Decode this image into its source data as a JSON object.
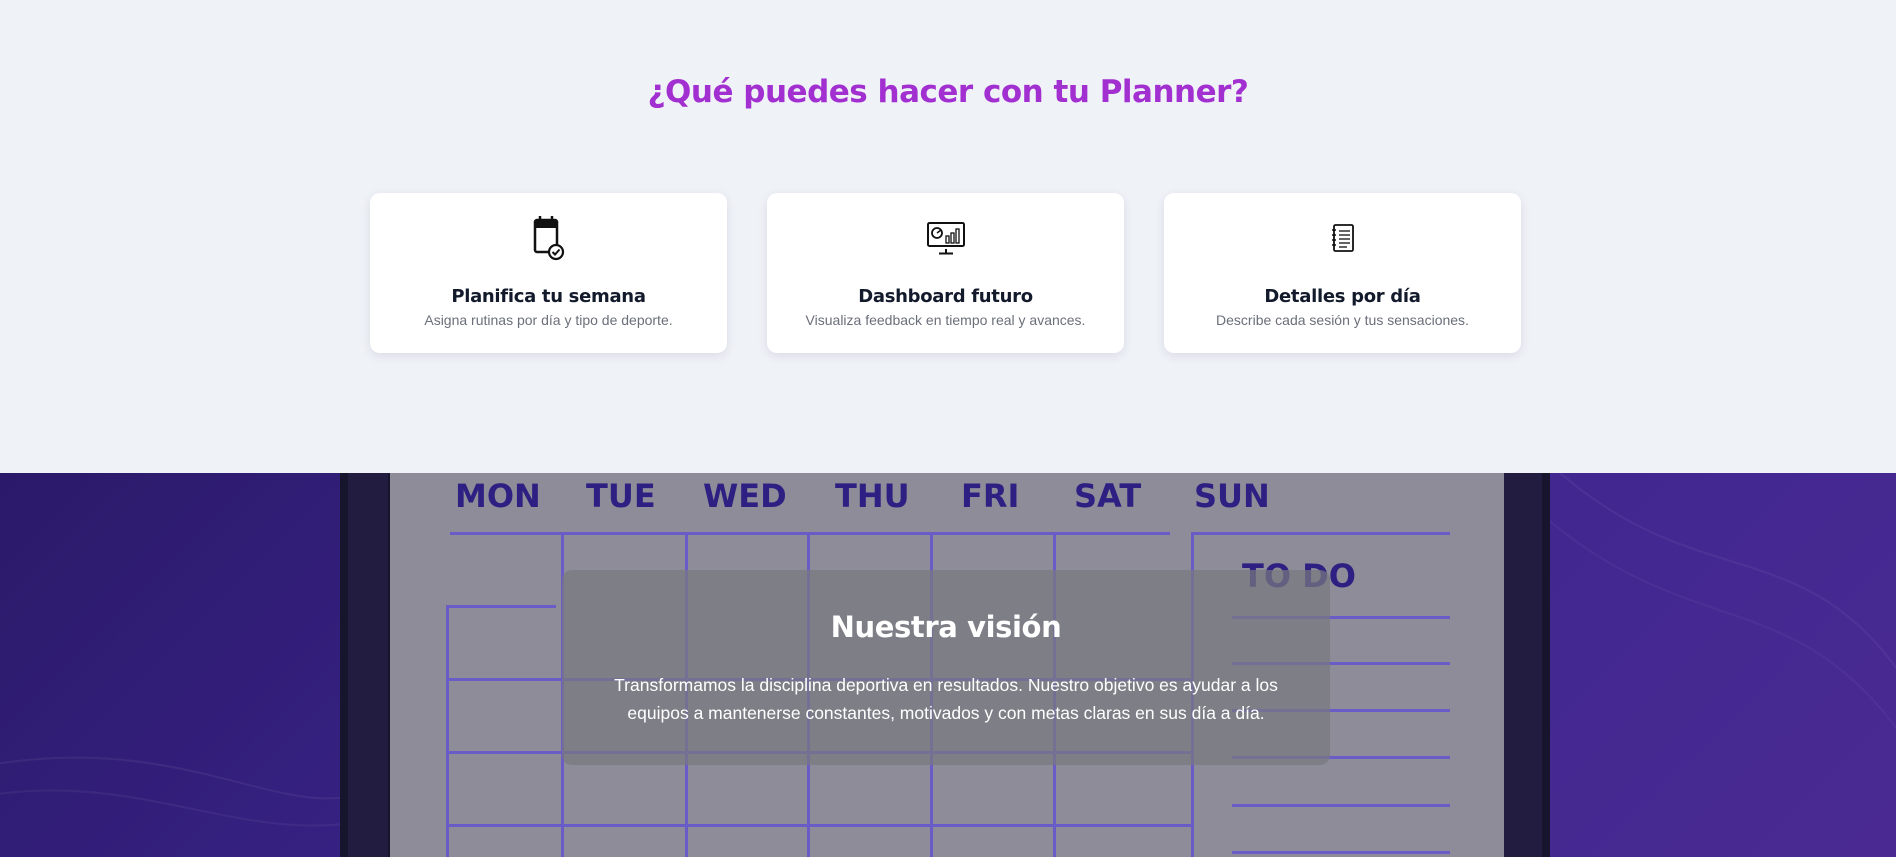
{
  "features": {
    "title": "¿Qué puedes hacer con tu Planner?",
    "cards": [
      {
        "icon": "calendar-check-icon",
        "title": "Planifica tu semana",
        "description": "Asigna rutinas por día y tipo de deporte."
      },
      {
        "icon": "monitor-chart-icon",
        "title": "Dashboard futuro",
        "description": "Visualiza feedback en tiempo real y avances."
      },
      {
        "icon": "notebook-list-icon",
        "title": "Detalles por día",
        "description": "Describe cada sesión y tus sensaciones."
      }
    ],
    "title_color": "#a22fd0"
  },
  "vision": {
    "title": "Nuestra visión",
    "text": "Transformamos la disciplina deportiva en resultados. Nuestro objetivo es ayudar a los equipos a mantenerse constantes, motivados y con metas claras en sus día a día.",
    "board_days": [
      "MON",
      "TUE",
      "WED",
      "THU",
      "FRI",
      "SAT",
      "SUN"
    ],
    "board_todo": "TO DO",
    "accent_color": "#3d2590"
  }
}
